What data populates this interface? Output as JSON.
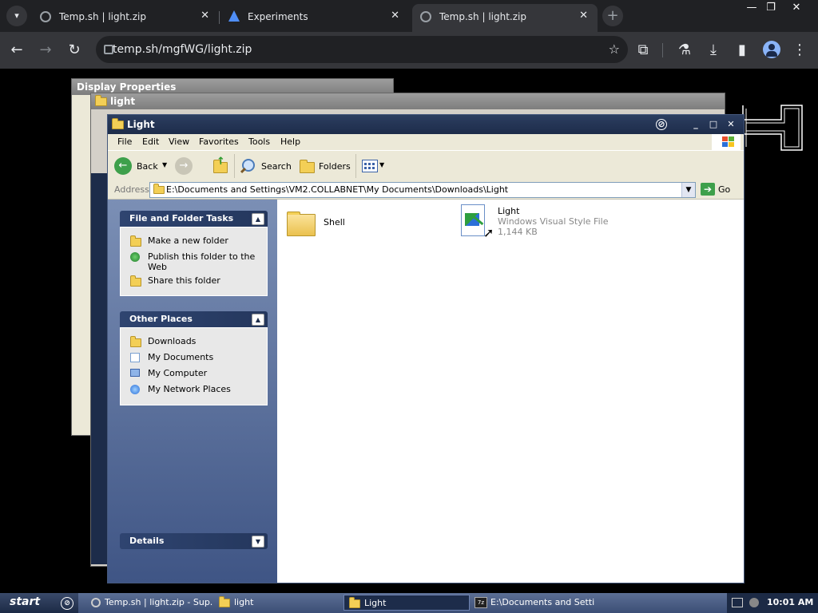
{
  "browser": {
    "tabs": [
      {
        "title": "Temp.sh | light.zip",
        "active": false
      },
      {
        "title": "Experiments",
        "active": false
      },
      {
        "title": "Temp.sh | light.zip",
        "active": true
      }
    ],
    "url": "temp.sh/mgfWG/light.zip"
  },
  "background_windows": {
    "display_properties_title": "Display Properties",
    "light_back_title": "light"
  },
  "window": {
    "title": "Light",
    "menu": [
      "File",
      "Edit",
      "View",
      "Favorites",
      "Tools",
      "Help"
    ],
    "toolbar": {
      "back": "Back",
      "search": "Search",
      "folders": "Folders"
    },
    "address": {
      "label": "Address",
      "value": "E:\\Documents and Settings\\VM2.COLLABNET\\My Documents\\Downloads\\Light",
      "go": "Go"
    },
    "taskpane": {
      "file_tasks": {
        "title": "File and Folder Tasks",
        "items": [
          "Make a new folder",
          "Publish this folder to the Web",
          "Share this folder"
        ]
      },
      "other_places": {
        "title": "Other Places",
        "items": [
          "Downloads",
          "My Documents",
          "My Computer",
          "My Network Places"
        ]
      },
      "details": {
        "title": "Details"
      }
    },
    "files": [
      {
        "name": "Shell",
        "type": "",
        "size": "",
        "icon": "folder-icon"
      },
      {
        "name": "Light",
        "type": "Windows Visual Style File",
        "size": "1,144 KB",
        "icon": "visual-style-file-icon"
      }
    ]
  },
  "taskbar": {
    "start": "start",
    "tasks": [
      "Temp.sh | light.zip - Sup...",
      "light",
      "Light",
      "E:\\Documents and Setti..."
    ],
    "active_task": 2,
    "clock": "10:01 AM"
  },
  "colors": {
    "title_blue": "#1d2c4a",
    "pane_blue": "#3f5585",
    "chrome_dark": "#202124"
  }
}
